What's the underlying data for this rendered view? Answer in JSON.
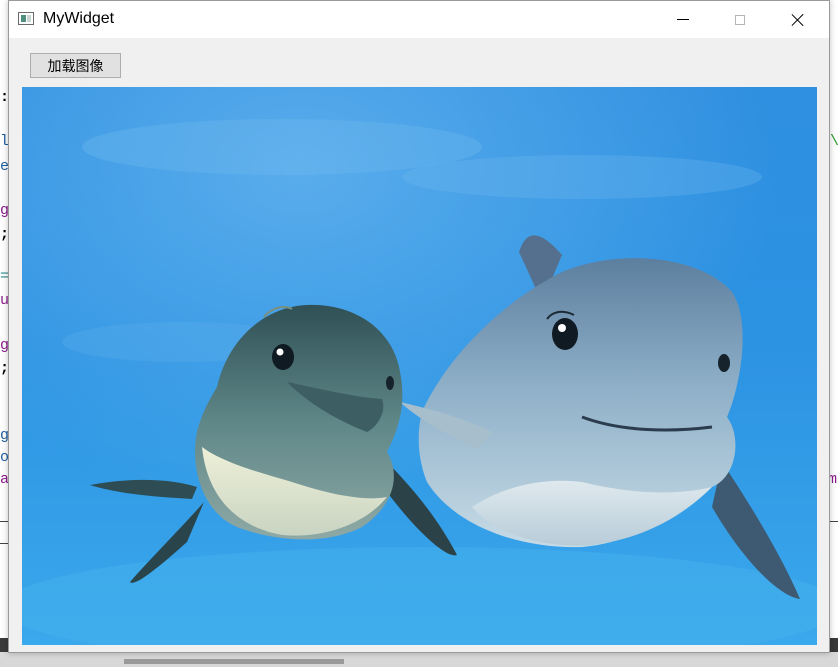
{
  "window": {
    "title": "MyWidget",
    "controls": {
      "minimize": "minimize-icon",
      "maximize": "maximize-icon",
      "close": "close-icon"
    }
  },
  "toolbar": {
    "load_button_label": "加载图像"
  },
  "image_label": {
    "content": "photo of two cartoon dolphins swimming underwater"
  },
  "background_editor": {
    "left_chars": [
      ":",
      "l",
      "e",
      "g",
      ";",
      "=",
      "u",
      "g",
      ";",
      "g",
      "o",
      "a"
    ],
    "right_chars": [
      "\\",
      "m"
    ]
  },
  "colors": {
    "window_bg": "#f0f0f0",
    "titlebar_bg": "#ffffff",
    "button_bg": "#e1e1e1",
    "water_top": "#2f8fe0",
    "water_bottom": "#3aa8ec"
  }
}
